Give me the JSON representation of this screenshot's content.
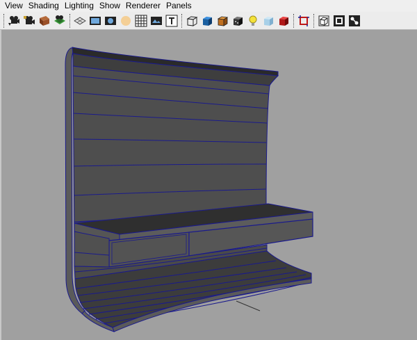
{
  "menubar": {
    "items": [
      {
        "label": "View"
      },
      {
        "label": "Shading"
      },
      {
        "label": "Lighting"
      },
      {
        "label": "Show"
      },
      {
        "label": "Renderer"
      },
      {
        "label": "Panels"
      }
    ]
  },
  "toolbar": {
    "groups": [
      [
        "select-camera-icon",
        "camera-attributes-icon",
        "bookmarks-icon",
        "image-plane-icon"
      ],
      [
        "grid-icon",
        "film-gate-icon",
        "resolution-gate-icon",
        "gate-mask-icon",
        "field-chart-icon",
        "safe-action-icon",
        "safe-title-icon"
      ],
      [
        "wireframe-icon",
        "smooth-shade-icon",
        "wireframe-on-shaded-icon",
        "xray-icon",
        "default-lighting-icon",
        "shadows-icon",
        "isolate-select-icon"
      ],
      [
        "highlight-selection-icon"
      ],
      [
        "xray-joints-icon",
        "xray-active-icon",
        "hypershade-icon"
      ]
    ]
  },
  "viewport": {
    "background": "#a0a0a0",
    "wire_color": "#1a1a8c",
    "face_color": "#4e4e4e"
  }
}
